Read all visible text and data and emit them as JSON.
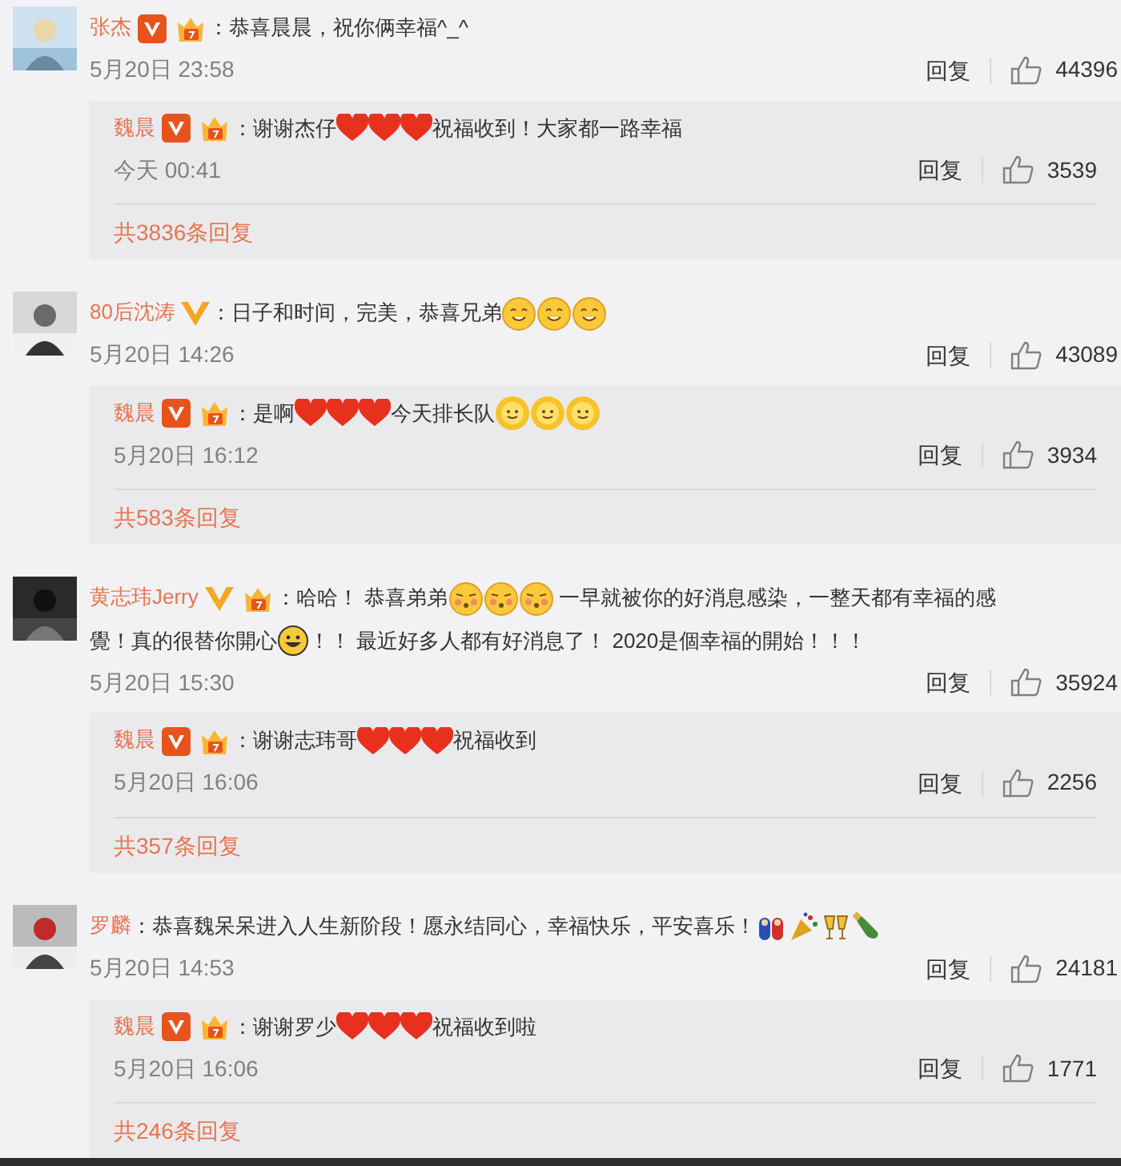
{
  "comments": [
    {
      "user": "张杰",
      "badges": [
        {
          "kind": "red-v"
        },
        {
          "kind": "fan"
        }
      ],
      "parts": [
        {
          "kind": "text",
          "text": "：恭喜晨晨，祝你俩幸福^_^"
        }
      ],
      "time": "5月20日 23:58",
      "reply_label": "回复",
      "likes": "44396",
      "reply": {
        "user": "魏晨",
        "badges": [
          {
            "kind": "red-v"
          },
          {
            "kind": "fan"
          }
        ],
        "parts": [
          {
            "kind": "text",
            "text": "：谢谢杰仔"
          },
          {
            "kind": "heart"
          },
          {
            "kind": "heart"
          },
          {
            "kind": "heart"
          },
          {
            "kind": "text",
            "text": "祝福收到！大家都一路幸福"
          }
        ],
        "time": "今天 00:41",
        "reply_label": "回复",
        "likes": "3539"
      },
      "more": "共3836条回复"
    },
    {
      "user": "80后沈涛",
      "badges": [
        {
          "kind": "gold-v"
        }
      ],
      "parts": [
        {
          "kind": "text",
          "text": "：日子和时间，完美，恭喜兄弟"
        },
        {
          "kind": "smile"
        },
        {
          "kind": "smile"
        },
        {
          "kind": "smile"
        }
      ],
      "time": "5月20日 14:26",
      "reply_label": "回复",
      "likes": "43089",
      "reply": {
        "user": "魏晨",
        "badges": [
          {
            "kind": "red-v"
          },
          {
            "kind": "fan"
          }
        ],
        "parts": [
          {
            "kind": "text",
            "text": "：是啊"
          },
          {
            "kind": "heart"
          },
          {
            "kind": "heart"
          },
          {
            "kind": "heart"
          },
          {
            "kind": "text",
            "text": "今天排长队"
          },
          {
            "kind": "sun"
          },
          {
            "kind": "sun"
          },
          {
            "kind": "sun"
          }
        ],
        "time": "5月20日 16:12",
        "reply_label": "回复",
        "likes": "3934"
      },
      "more": "共583条回复"
    },
    {
      "user": "黄志玮Jerry",
      "badges": [
        {
          "kind": "gold-v"
        },
        {
          "kind": "fan"
        }
      ],
      "parts": [
        {
          "kind": "text",
          "text": "：哈哈！ 恭喜弟弟"
        },
        {
          "kind": "kiss"
        },
        {
          "kind": "kiss"
        },
        {
          "kind": "kiss"
        },
        {
          "kind": "text",
          "text": " 一早就被你的好消息感染，一整天都有幸福的感"
        },
        {
          "kind": "text",
          "text": "覺！真的很替你開心"
        },
        {
          "kind": "grin"
        },
        {
          "kind": "text",
          "text": "！！ 最近好多人都有好消息了！ 2020是個幸福的開始！！！"
        }
      ],
      "time": "5月20日 15:30",
      "reply_label": "回复",
      "likes": "35924",
      "reply": {
        "user": "魏晨",
        "badges": [
          {
            "kind": "red-v"
          },
          {
            "kind": "fan"
          }
        ],
        "parts": [
          {
            "kind": "text",
            "text": "：谢谢志玮哥"
          },
          {
            "kind": "heart"
          },
          {
            "kind": "heart"
          },
          {
            "kind": "heart"
          },
          {
            "kind": "text",
            "text": "祝福收到"
          }
        ],
        "time": "5月20日 16:06",
        "reply_label": "回复",
        "likes": "2256"
      },
      "more": "共357条回复"
    },
    {
      "user": "罗麟",
      "parts": [
        {
          "kind": "text",
          "text": "：恭喜魏呆呆进入人生新阶段！愿永结同心，幸福快乐，平安喜乐！"
        },
        {
          "kind": "dolls"
        },
        {
          "kind": "popper"
        },
        {
          "kind": "cheers"
        },
        {
          "kind": "bottle"
        }
      ],
      "time": "5月20日 14:53",
      "reply_label": "回复",
      "likes": "24181",
      "reply": {
        "user": "魏晨",
        "badges": [
          {
            "kind": "red-v"
          },
          {
            "kind": "fan"
          }
        ],
        "parts": [
          {
            "kind": "text",
            "text": "：谢谢罗少"
          },
          {
            "kind": "heart"
          },
          {
            "kind": "heart"
          },
          {
            "kind": "heart"
          },
          {
            "kind": "text",
            "text": "祝福收到啦"
          }
        ],
        "time": "5月20日 16:06",
        "reply_label": "回复",
        "likes": "1771"
      },
      "more": "共246条回复"
    }
  ]
}
